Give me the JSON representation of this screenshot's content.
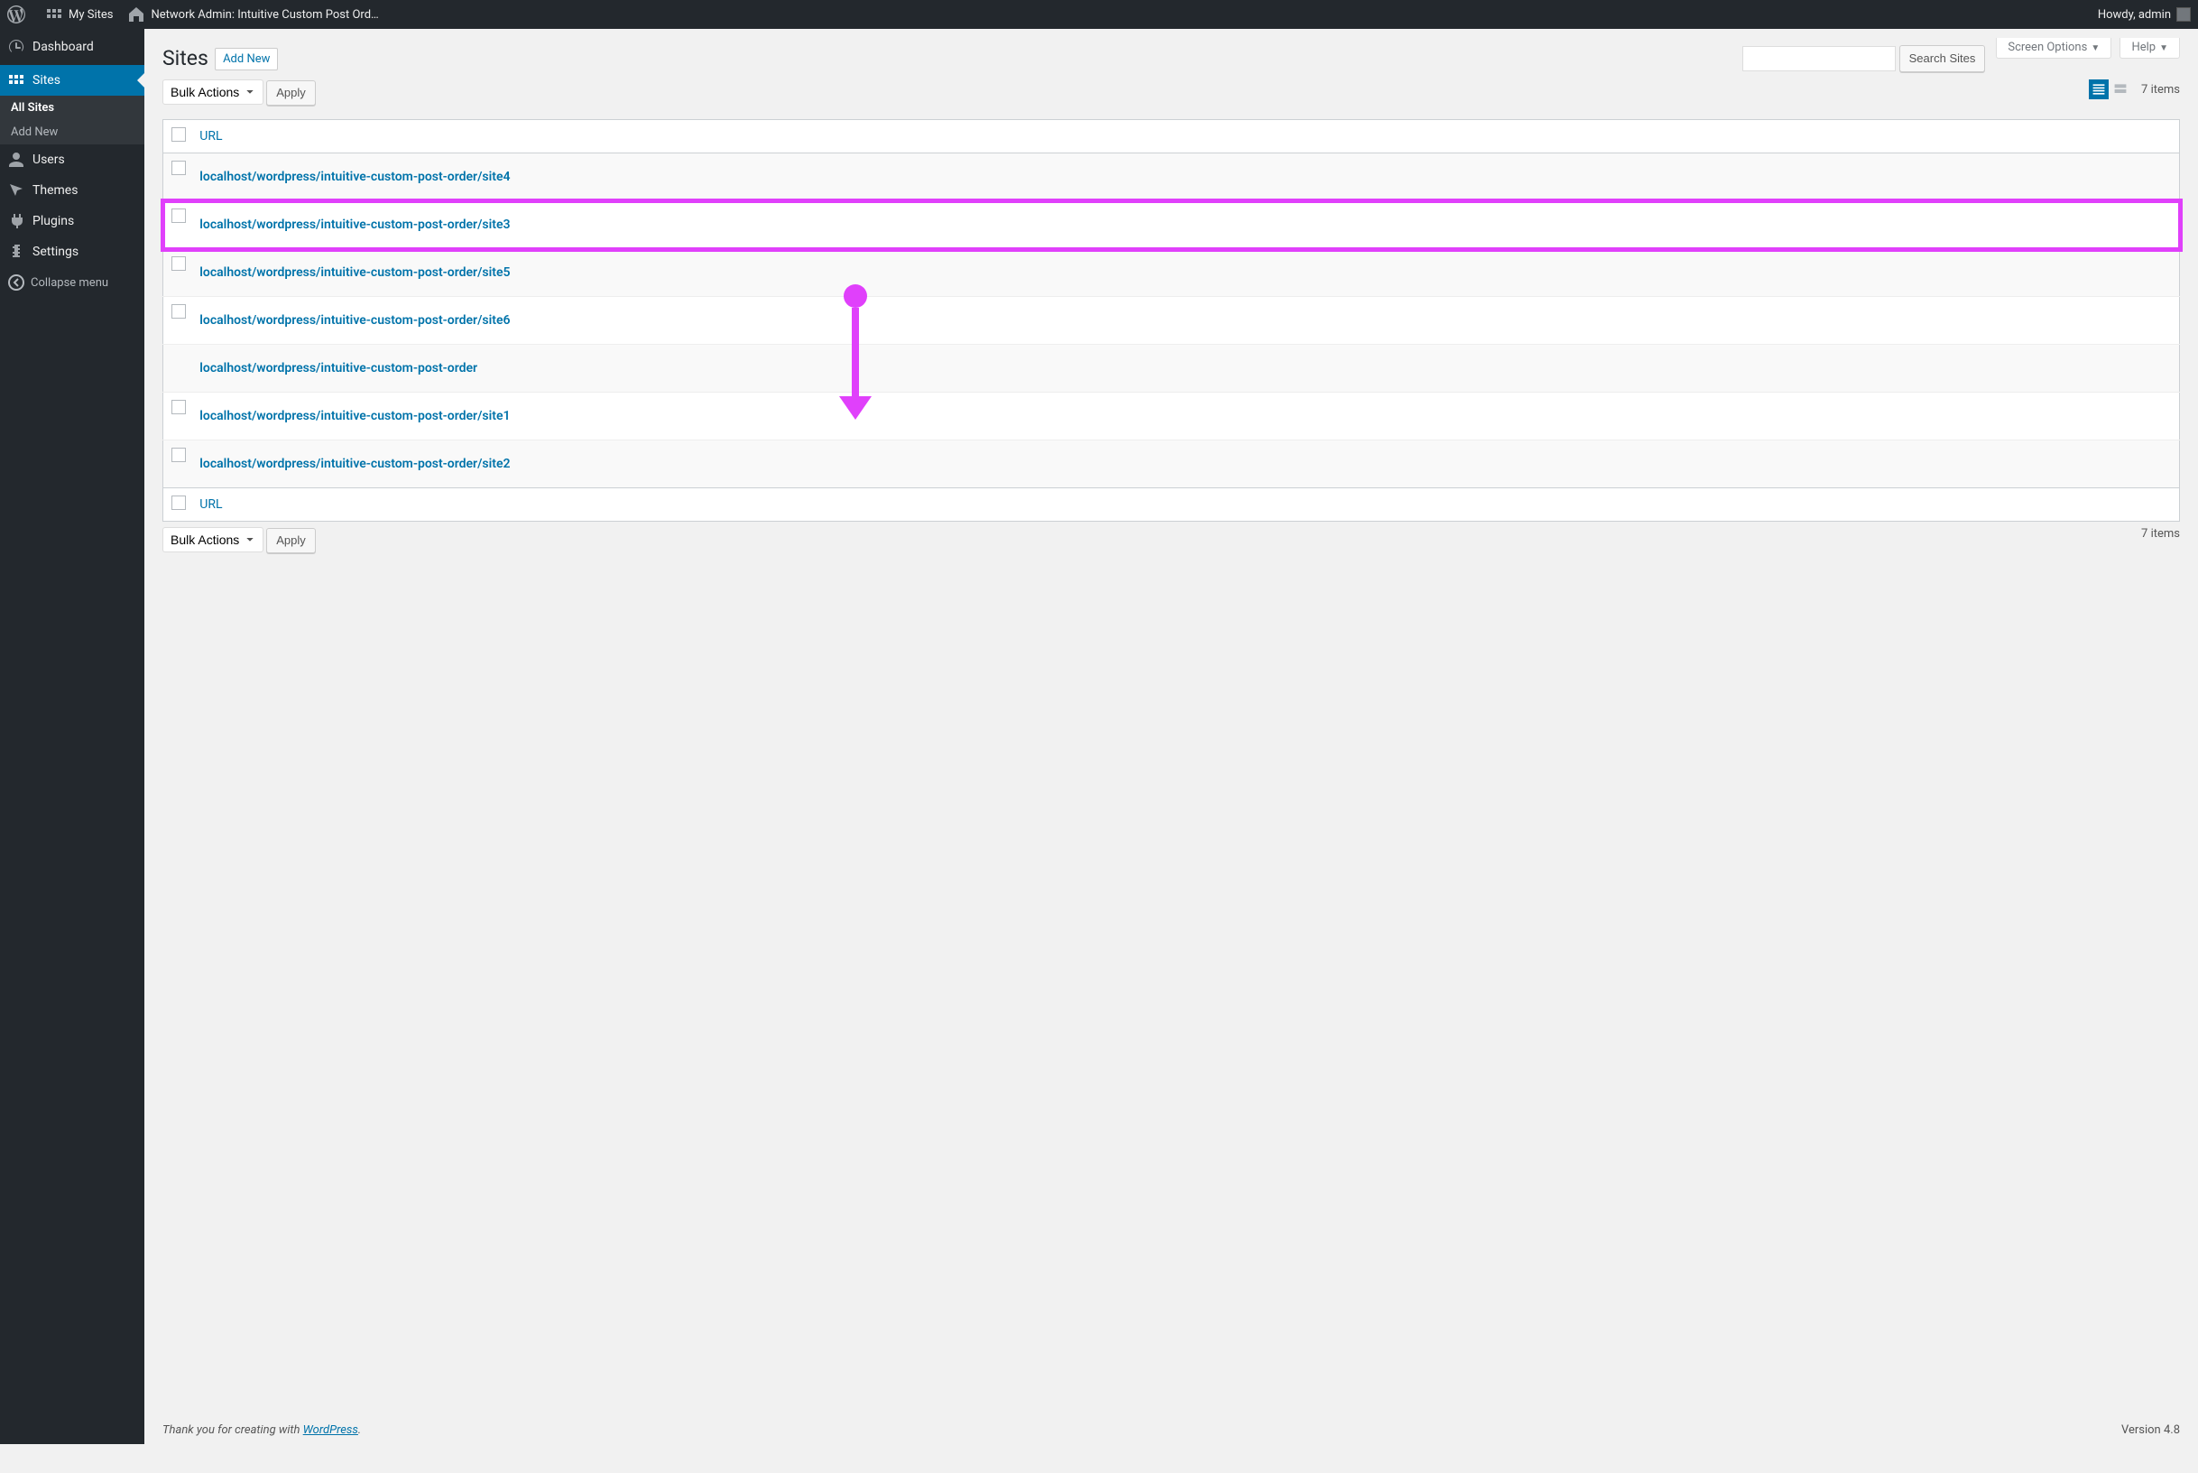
{
  "adminbar": {
    "my_sites": "My Sites",
    "site_title": "Network Admin: Intuitive Custom Post Ord…",
    "howdy": "Howdy, admin"
  },
  "sidebar": {
    "items": [
      {
        "label": "Dashboard"
      },
      {
        "label": "Sites"
      },
      {
        "label": "Users"
      },
      {
        "label": "Themes"
      },
      {
        "label": "Plugins"
      },
      {
        "label": "Settings"
      }
    ],
    "submenu": [
      {
        "label": "All Sites"
      },
      {
        "label": "Add New"
      }
    ],
    "collapse": "Collapse menu"
  },
  "screen_meta": {
    "screen_options": "Screen Options",
    "help": "Help"
  },
  "heading": {
    "title": "Sites",
    "add_new": "Add New"
  },
  "search": {
    "button": "Search Sites"
  },
  "bulk": {
    "label": "Bulk Actions",
    "apply": "Apply"
  },
  "pagination": {
    "items_text": "7 items"
  },
  "table": {
    "column_url": "URL",
    "rows": [
      {
        "url": "localhost/wordpress/intuitive-custom-post-order/site4",
        "has_check": true,
        "highlighted": false
      },
      {
        "url": "localhost/wordpress/intuitive-custom-post-order/site3",
        "has_check": true,
        "highlighted": true
      },
      {
        "url": "localhost/wordpress/intuitive-custom-post-order/site5",
        "has_check": true,
        "highlighted": false
      },
      {
        "url": "localhost/wordpress/intuitive-custom-post-order/site6",
        "has_check": true,
        "highlighted": false
      },
      {
        "url": "localhost/wordpress/intuitive-custom-post-order",
        "has_check": false,
        "highlighted": false
      },
      {
        "url": "localhost/wordpress/intuitive-custom-post-order/site1",
        "has_check": true,
        "highlighted": false
      },
      {
        "url": "localhost/wordpress/intuitive-custom-post-order/site2",
        "has_check": true,
        "highlighted": false
      }
    ]
  },
  "footer": {
    "thank_prefix": "Thank you for creating with ",
    "thank_link": "WordPress",
    "thank_suffix": ".",
    "version": "Version 4.8"
  }
}
